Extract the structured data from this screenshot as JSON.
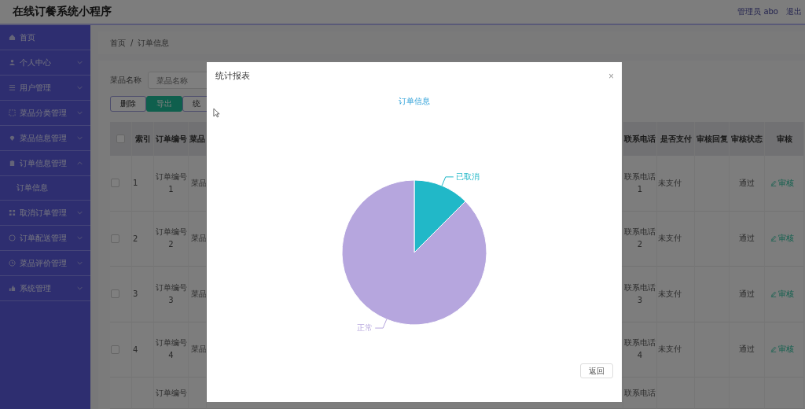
{
  "header": {
    "title": "在线订餐系统小程序",
    "user": "管理员 abo",
    "logout": "退出"
  },
  "sidebar": {
    "items": [
      {
        "label": "首页"
      },
      {
        "label": "个人中心",
        "expanded": false
      },
      {
        "label": "用户管理",
        "expanded": false
      },
      {
        "label": "菜品分类管理",
        "expanded": false
      },
      {
        "label": "菜品信息管理",
        "expanded": false
      },
      {
        "label": "订单信息管理",
        "expanded": true,
        "children": [
          {
            "label": "订单信息"
          }
        ]
      },
      {
        "label": "取消订单管理",
        "expanded": false
      },
      {
        "label": "订单配送管理",
        "expanded": false
      },
      {
        "label": "菜品评价管理",
        "expanded": false
      },
      {
        "label": "系统管理",
        "expanded": false
      }
    ]
  },
  "breadcrumb": [
    "首页",
    "/",
    "订单信息"
  ],
  "search": {
    "label": "菜品名称",
    "placeholder": "菜品名称"
  },
  "toolbar": [
    "删除",
    "导出",
    "统"
  ],
  "table": {
    "columns": [
      "索引",
      "订单编号",
      "菜品",
      "联系电话",
      "是否支付",
      "审核回复",
      "审核状态",
      "审核"
    ],
    "all_checked": false,
    "rows": [
      {
        "checked": false,
        "index": "1",
        "order_no": "订单编号 1",
        "dish": "菜品",
        "phone": "联系电话 1",
        "paid": "未支付",
        "status": "通过",
        "action": "审核"
      },
      {
        "checked": false,
        "index": "2",
        "order_no": "订单编号 2",
        "dish": "菜品",
        "phone": "联系电话 2",
        "paid": "未支付",
        "status": "通过",
        "action": "审核"
      },
      {
        "checked": false,
        "index": "3",
        "order_no": "订单编号 3",
        "dish": "菜品",
        "phone": "联系电话 3",
        "paid": "未支付",
        "status": "通过",
        "action": "审核"
      },
      {
        "checked": false,
        "index": "4",
        "order_no": "订单编号 4",
        "dish": "菜品",
        "phone": "联系电话 4",
        "paid": "未支付",
        "status": "通过",
        "action": "审核"
      }
    ],
    "partial_row": {
      "order_no": "订单编号",
      "phone": "联系电话"
    }
  },
  "dialog": {
    "title": "统计报表",
    "close": "×",
    "button": "返回",
    "chart_data": {
      "type": "pie",
      "title": "订单信息",
      "categories": [
        "已取消",
        "正常"
      ],
      "values": [
        12.5,
        87.5
      ]
    }
  }
}
